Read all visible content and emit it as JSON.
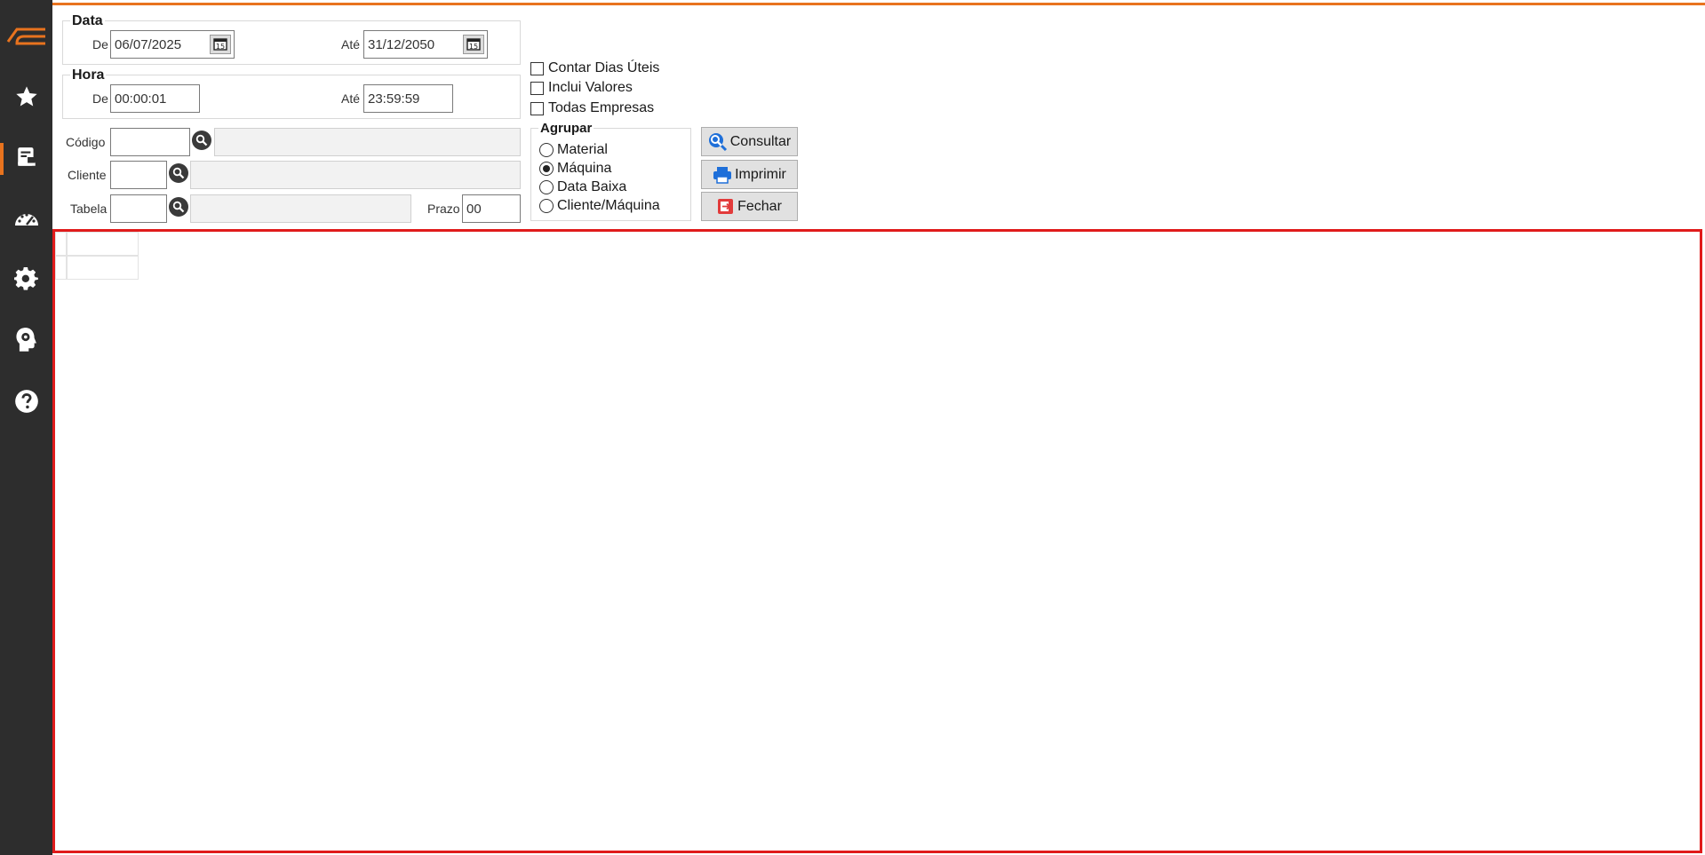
{
  "colors": {
    "accent": "#e8731e",
    "sidebar_bg": "#2d2d2d",
    "grid_border": "#e01b1b",
    "search_blue": "#1e6fd9",
    "close_red": "#e23b3b"
  },
  "sidebar": {
    "items": [
      {
        "icon": "logo-icon"
      },
      {
        "icon": "star-icon"
      },
      {
        "icon": "report-icon",
        "active": true
      },
      {
        "icon": "speedometer-icon"
      },
      {
        "icon": "gear-icon"
      },
      {
        "icon": "head-gear-icon"
      },
      {
        "icon": "help-icon"
      }
    ]
  },
  "data_group": {
    "title": "Data",
    "from_label": "De",
    "from_value": "06/07/2025",
    "to_label": "Até",
    "to_value": "31/12/2050"
  },
  "hour_group": {
    "title": "Hora",
    "from_label": "De",
    "from_value": "00:00:01",
    "to_label": "Até",
    "to_value": "23:59:59"
  },
  "filters": {
    "codigo_label": "Código",
    "codigo_value": "",
    "codigo_desc": "",
    "cliente_label": "Cliente",
    "cliente_value": "",
    "cliente_desc": "",
    "tabela_label": "Tabela",
    "tabela_value": "",
    "tabela_desc": "",
    "prazo_label": "Prazo",
    "prazo_value": "00"
  },
  "checkboxes": [
    {
      "label": "Contar Dias Úteis",
      "checked": false
    },
    {
      "label": "Inclui Valores",
      "checked": false
    },
    {
      "label": "Todas Empresas",
      "checked": false
    }
  ],
  "agrupar": {
    "title": "Agrupar",
    "options": [
      {
        "label": "Material",
        "selected": false
      },
      {
        "label": "Máquina",
        "selected": true
      },
      {
        "label": "Data Baixa",
        "selected": false
      },
      {
        "label": "Cliente/Máquina",
        "selected": false
      }
    ]
  },
  "buttons": {
    "consultar": "Consultar",
    "imprimir": "Imprimir",
    "fechar": "Fechar"
  }
}
